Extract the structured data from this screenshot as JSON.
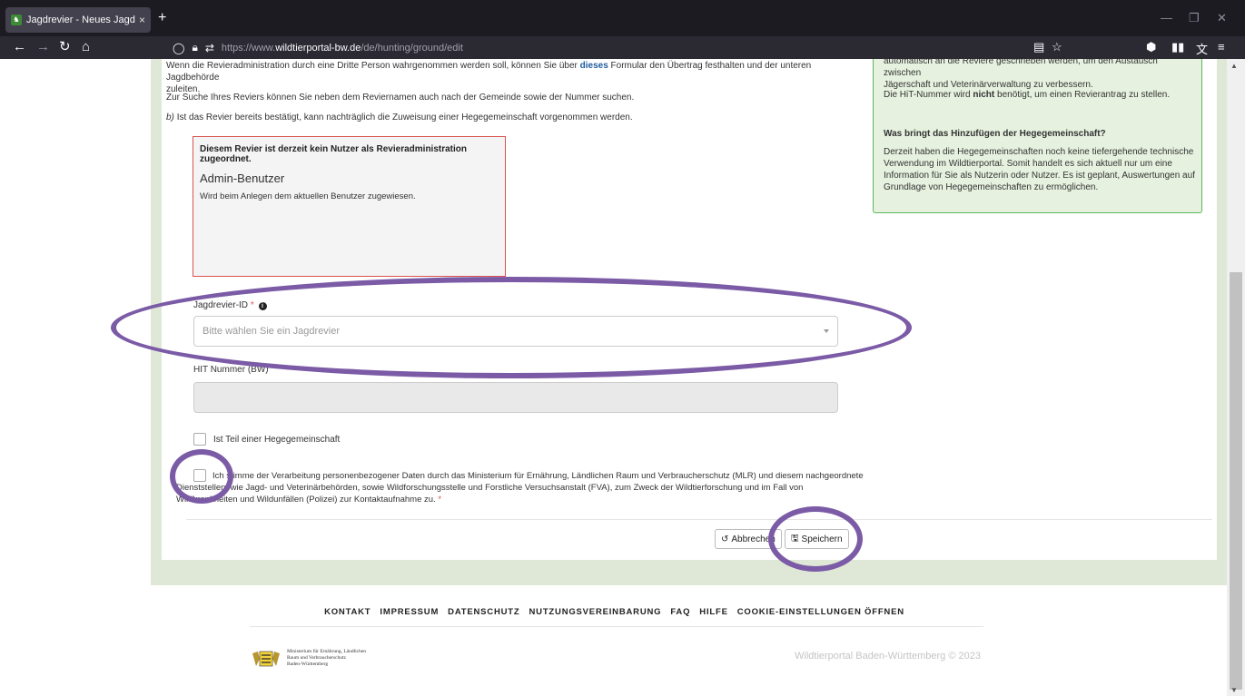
{
  "browser": {
    "tab_title": "Jagdrevier - Neues Jagdrevier -",
    "tab_close": "×",
    "new_tab": "+",
    "url_prefix": "https://www.",
    "url_domain": "wildtierportal-bw.de",
    "url_path": "/de/hunting/ground/edit"
  },
  "content": {
    "intro_line1": "Wenn die Revieradministration durch eine Dritte Person wahrgenommen werden soll, können Sie über",
    "intro_link": "dieses",
    "intro_line1_end": "Formular den Übertrag festhalten und der unteren Jagdbehörde",
    "intro_line2": "zuleiten.",
    "search_hint": "Zur Suche Ihres Reviers können Sie neben dem Reviernamen auch nach der Gemeinde sowie der Nummer suchen.",
    "b_prefix": "b)",
    "b_text": "Ist das Revier bereits bestätigt, kann nachträglich die Zuweisung einer Hegegemeinschaft vorgenommen werden."
  },
  "admin_box": {
    "warning": "Diesem Revier ist derzeit kein Nutzer als Revieradministration zugeordnet.",
    "heading": "Admin-Benutzer",
    "description": "Wird beim Anlegen dem aktuellen Benutzer zugewiesen."
  },
  "form": {
    "jagdrevier_label": "Jagdrevier-ID",
    "required_mark": "*",
    "info_glyph": "i",
    "jagdrevier_placeholder": "Bitte wählen Sie ein Jagdrevier",
    "hit_label": "HIT Nummer (BW)",
    "hegegemeinschaft_label": "Ist Teil einer Hegegemeinschaft",
    "consent_line1": "Ich stimme der Verarbeitung personenbezogener Daten durch das Ministerium für Ernährung, Ländlichen Raum und Verbraucherschutz (MLR) und diesem nachgeordnete",
    "consent_line2": "Dienststellen, wie Jagd- und Veterinärbehörden, sowie Wildforschungsstelle und Forstliche Versuchsanstalt (FVA), zum Zweck der Wildtierforschung und im Fall von",
    "consent_line3": "Wildkrankheiten und Wildunfällen (Polizei) zur Kontaktaufnahme zu.",
    "cancel_label": "Abbrechen",
    "save_label": "Speichern"
  },
  "infobox": {
    "line1": "automatisch an die Reviere geschrieben werden, um den Austausch zwischen",
    "line2": "Jägerschaft und Veterinärverwaltung zu verbessern.",
    "hit_note_pre": "Die HiT-Nummer wird",
    "hit_note_bold": "nicht",
    "hit_note_post": "benötigt, um einen Revierantrag zu stellen.",
    "heading": "Was bringt das Hinzufügen der Hegegemeinschaft?",
    "body1": "Derzeit haben die Hegegemeinschaften noch keine tiefergehende technische",
    "body2": "Verwendung im Wildtierportal. Somit handelt es sich aktuell nur um eine",
    "body3": "Information für Sie als Nutzerin oder Nutzer. Es ist geplant, Auswertungen auf",
    "body4": "Grundlage von Hegegemeinschaften zu ermöglichen."
  },
  "footer": {
    "links": [
      "KONTAKT",
      "IMPRESSUM",
      "DATENSCHUTZ",
      "NUTZUNGSVEREINBARUNG",
      "FAQ",
      "HILFE",
      "COOKIE-EINSTELLUNGEN ÖFFNEN"
    ],
    "ministry_line1": "Ministerium für Ernährung, Ländlichen",
    "ministry_line2": "Raum und Verbraucherschutz",
    "ministry_line3": "Baden-Württemberg",
    "copyright": "Wildtierportal Baden-Württemberg © 2023"
  },
  "colors": {
    "annotation": "#7b5ba6",
    "page_bg_green": "#dfe8d6",
    "info_border": "#5cb85c",
    "error_border": "#d9534f",
    "link": "#1f5c9e"
  }
}
